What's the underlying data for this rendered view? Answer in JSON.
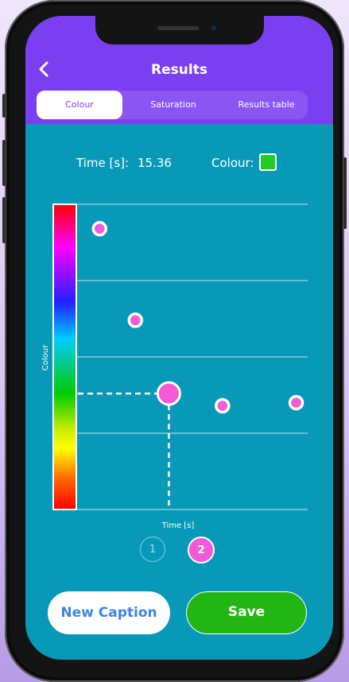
{
  "header": {
    "title": "Results",
    "back_icon": "chevron-left-icon"
  },
  "tabs": [
    {
      "label": "Colour",
      "active": true
    },
    {
      "label": "Saturation",
      "active": false
    },
    {
      "label": "Results table",
      "active": false
    }
  ],
  "info": {
    "time_label": "Time [s]:",
    "time_value": "15.36",
    "colour_label": "Colour:",
    "colour_value": "#22cc22"
  },
  "chart_data": {
    "type": "scatter",
    "xlabel": "Time [s]",
    "ylabel": "Colour",
    "grid": true,
    "colour_scale": [
      "#ff0000",
      "#ff00ff",
      "#2020ff",
      "#00ccff",
      "#00cc00",
      "#ffff00",
      "#ff6600",
      "#ff0000"
    ],
    "points": [
      {
        "x": 0.09,
        "y": 0.92,
        "size": "small"
      },
      {
        "x": 0.25,
        "y": 0.62,
        "size": "small"
      },
      {
        "x": 0.4,
        "y": 0.38,
        "size": "large",
        "selected": true
      },
      {
        "x": 0.64,
        "y": 0.34,
        "size": "small"
      },
      {
        "x": 0.97,
        "y": 0.35,
        "size": "small"
      }
    ]
  },
  "pagination": [
    {
      "label": "1",
      "active": false
    },
    {
      "label": "2",
      "active": true
    }
  ],
  "buttons": {
    "new_caption": "New Caption",
    "save": "Save"
  }
}
